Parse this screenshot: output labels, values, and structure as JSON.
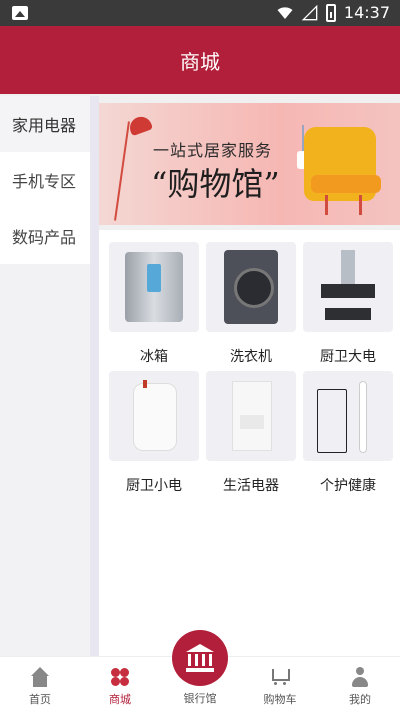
{
  "status_bar": {
    "time": "14:37"
  },
  "header": {
    "title": "商城"
  },
  "sidebar": {
    "items": [
      {
        "label": "家用电器"
      },
      {
        "label": "手机专区"
      },
      {
        "label": "数码产品"
      }
    ]
  },
  "banner": {
    "headline1": "一站式居家服务",
    "headline2": "“购物馆”"
  },
  "products": [
    {
      "label": "冰箱",
      "icon": "fridge-image"
    },
    {
      "label": "洗衣机",
      "icon": "washing-machine-image"
    },
    {
      "label": "厨卫大电",
      "icon": "range-hood-image"
    },
    {
      "label": "厨卫小电",
      "icon": "water-heater-image"
    },
    {
      "label": "生活电器",
      "icon": "water-purifier-image"
    },
    {
      "label": "个护健康",
      "icon": "electric-toothbrush-image"
    }
  ],
  "bottom_nav": {
    "home": "首页",
    "mall": "商城",
    "bank": "银行馆",
    "cart": "购物车",
    "me": "我的"
  },
  "colors": {
    "brand": "#b21f3a"
  }
}
